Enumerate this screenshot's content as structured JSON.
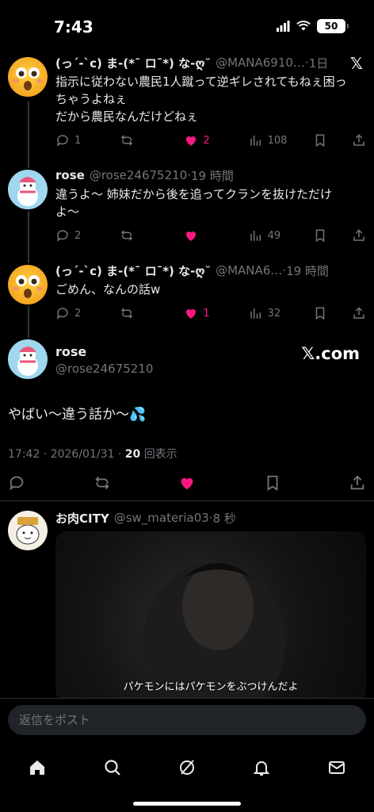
{
  "status": {
    "time": "7:43",
    "battery": "50"
  },
  "tweets": [
    {
      "name": "(っ´-`c) ま-(*¯ ロ¯*) な-ღ˘",
      "handle": "@MANA6910…",
      "time": "1日",
      "text_lines": [
        "指示に従わない農民1人蹴って逆ギレされてもねぇ困っ",
        "ちゃうよねぇ",
        "だから農民なんだけどねぇ"
      ],
      "replies": "1",
      "likes": "2",
      "views": "108",
      "liked": true
    },
    {
      "name": "rose",
      "handle": "@rose24675210",
      "time": "19 時間",
      "text_lines": [
        "違うよ〜 姉妹だから後を追ってクランを抜けただけ",
        "よ〜"
      ],
      "replies": "2",
      "likes": "",
      "views": "49",
      "liked": true
    },
    {
      "name": "(っ´-`c) ま-(*¯ ロ¯*) な-ღ˘",
      "handle": "@MANA6…",
      "time": "19 時間",
      "text_lines": [
        "ごめん、なんの話w"
      ],
      "replies": "2",
      "likes": "1",
      "views": "32",
      "liked": true
    }
  ],
  "main": {
    "name": "rose",
    "handle": "@rose24675210",
    "source": "𝕏.com",
    "text": "やばい〜違う話か〜💦",
    "timestamp": "17:42 · 2026/01/31 · ",
    "views_count": "20",
    "views_label": "回表示"
  },
  "next": {
    "name": "お肉CITY",
    "handle": "@sw_materia03",
    "time": "8 秒",
    "subtitle": "パケモンにはパケモンをぶつけんだよ"
  },
  "reply_placeholder": "返信をポスト",
  "colors": {
    "like": "#f91880",
    "muted": "#71767b",
    "text": "#e7e9ea"
  },
  "icons": [
    "home-icon",
    "search-icon",
    "grok-icon",
    "bell-icon",
    "mail-icon"
  ]
}
